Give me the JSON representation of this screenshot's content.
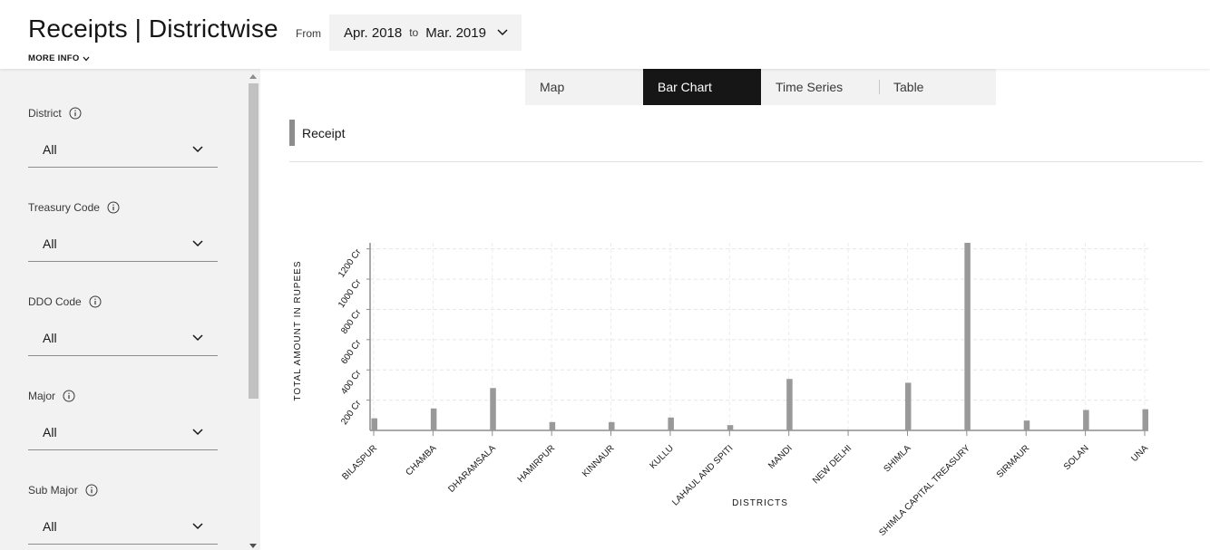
{
  "header": {
    "title": "Receipts | Districtwise",
    "from_label": "From",
    "date_from": "Apr. 2018",
    "date_to_label": "to",
    "date_to": "Mar. 2019",
    "more_info": "MORE INFO"
  },
  "sidebar": {
    "filters": [
      {
        "label": "District",
        "value": "All"
      },
      {
        "label": "Treasury Code",
        "value": "All"
      },
      {
        "label": "DDO Code",
        "value": "All"
      },
      {
        "label": "Major",
        "value": "All"
      },
      {
        "label": "Sub Major",
        "value": "All"
      }
    ]
  },
  "tabs": [
    {
      "label": "Map",
      "active": false
    },
    {
      "label": "Bar Chart",
      "active": true
    },
    {
      "label": "Time Series",
      "active": false
    },
    {
      "label": "Table",
      "active": false
    }
  ],
  "section": {
    "title": "Receipt"
  },
  "colors": {
    "bar": "#999999",
    "accent": "#161616",
    "sidebar_bg": "#f2f2f2"
  },
  "chart_data": {
    "type": "bar",
    "title": "",
    "xlabel": "DISTRICTS",
    "ylabel": "TOTAL AMOUNT IN RUPEES",
    "ylim": [
      0,
      1240
    ],
    "yticks": [
      200,
      400,
      600,
      800,
      1000,
      1200
    ],
    "ytick_suffix": " Cr",
    "grid": true,
    "categories": [
      "BILASPUR",
      "CHAMBA",
      "DHARAMSALA",
      "HAMIRPUR",
      "KINNAUR",
      "KULLU",
      "LAHAUL AND SPITI",
      "MANDI",
      "NEW DELHI",
      "SHIMLA",
      "SHIMLA CAPITAL TREASURY",
      "SIRMAUR",
      "SOLAN",
      "UNA"
    ],
    "series": [
      {
        "values": [
          80,
          145,
          280,
          55,
          55,
          85,
          35,
          340,
          0,
          315,
          1240,
          65,
          135,
          140
        ]
      }
    ]
  }
}
